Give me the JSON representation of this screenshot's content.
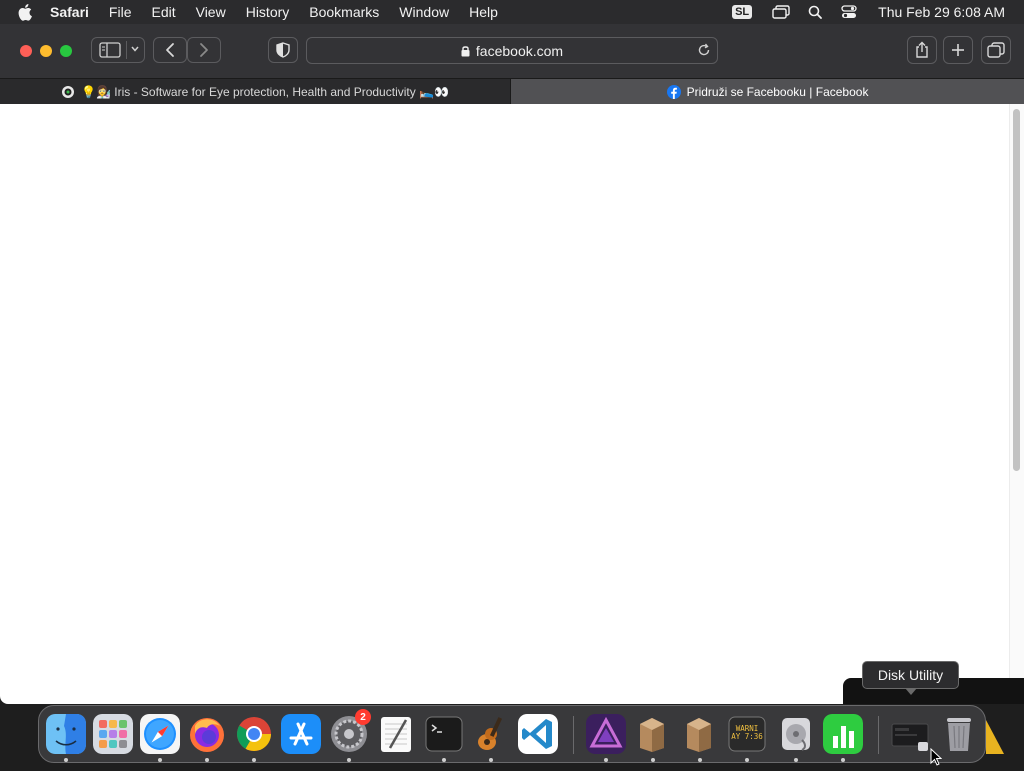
{
  "menubar": {
    "app_name": "Safari",
    "items": [
      "File",
      "Edit",
      "View",
      "History",
      "Bookmarks",
      "Window",
      "Help"
    ],
    "input_badge": "SL",
    "clock": "Thu Feb 29  6:08 AM"
  },
  "toolbar": {
    "url": "facebook.com"
  },
  "tabs": [
    {
      "title": "💡👩‍🔬 Iris - Software for Eye protection, Health and Productivity 🛌👀",
      "active": false
    },
    {
      "title": "Pridruži se Facebooku | Facebook",
      "active": true
    }
  ],
  "tooltip": {
    "text": "Disk Utility"
  },
  "dock": {
    "apps": [
      {
        "name": "Finder",
        "icon": "finder-icon"
      },
      {
        "name": "Launchpad",
        "icon": "launchpad-icon"
      },
      {
        "name": "Safari",
        "icon": "safari-icon"
      },
      {
        "name": "Firefox",
        "icon": "firefox-icon"
      },
      {
        "name": "Google Chrome",
        "icon": "chrome-icon"
      },
      {
        "name": "App Store",
        "icon": "app-store-icon"
      },
      {
        "name": "System Settings",
        "icon": "system-settings-icon",
        "badge": "2"
      },
      {
        "name": "TextEdit",
        "icon": "textedit-icon"
      },
      {
        "name": "Terminal",
        "icon": "terminal-icon"
      },
      {
        "name": "GarageBand",
        "icon": "garageband-icon"
      },
      {
        "name": "Visual Studio Code",
        "icon": "vscode-icon"
      },
      {
        "name": "Affinity Photo",
        "icon": "affinity-photo-icon"
      },
      {
        "name": "Installer",
        "icon": "installer-icon"
      },
      {
        "name": "Installer",
        "icon": "installer-icon"
      },
      {
        "name": "Console",
        "icon": "console-icon",
        "label": "WARNI\nAY 7:36"
      },
      {
        "name": "Disk Utility",
        "icon": "disk-utility-icon"
      },
      {
        "name": "Numbers",
        "icon": "numbers-icon"
      },
      {
        "name": "Disk Utility Window",
        "icon": "window-thumbnail-icon"
      },
      {
        "name": "Trash",
        "icon": "trash-icon"
      }
    ]
  },
  "colors": {
    "close": "#fe5f57",
    "minimize": "#febc2e",
    "zoom": "#28c840",
    "badge": "#ff3b30"
  }
}
